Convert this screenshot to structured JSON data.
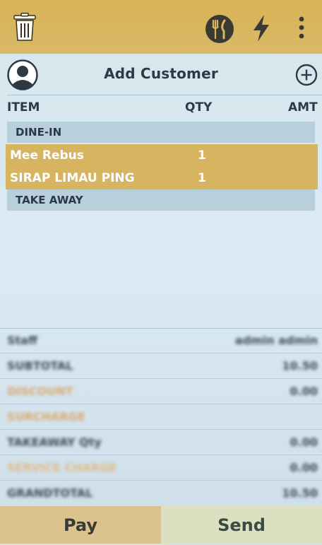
{
  "colors": {
    "accent": "#d8b256",
    "section_bg": "#b8cfdc",
    "selected_row": "#d7b460",
    "pay_button": "#dcc28c",
    "send_button": "#dce0c0",
    "summary_highlight": "#e6b88a"
  },
  "toolbar": {
    "icons": [
      "trash-icon",
      "restaurant-icon",
      "lightning-icon",
      "more-vertical-icon"
    ]
  },
  "customer": {
    "label": "Add Customer",
    "avatar_icon": "user-avatar-icon",
    "add_icon": "plus-circle-icon"
  },
  "order_table": {
    "headers": {
      "item": "ITEM",
      "qty": "QTY",
      "amt": "AMT"
    },
    "sections": [
      {
        "label": "DINE-IN",
        "items": [
          {
            "name": "Mee Rebus",
            "qty": "1",
            "amt": ""
          },
          {
            "name": "SIRAP LIMAU PING",
            "qty": "1",
            "amt": ""
          }
        ]
      },
      {
        "label": "TAKE AWAY",
        "items": []
      }
    ]
  },
  "summary": [
    {
      "label": "Staff",
      "value": "admin admin"
    },
    {
      "label": "SUBTOTAL",
      "value": "10.50"
    },
    {
      "label": "DISCOUNT",
      "value": "0.00"
    },
    {
      "label": "SURCHARGE",
      "value": ""
    },
    {
      "label": "TAKEAWAY Qty",
      "value": "0.00"
    },
    {
      "label": "SERVICE CHARGE",
      "value": "0.00"
    },
    {
      "label": "GRANDTOTAL",
      "value": "10.50"
    }
  ],
  "actions": {
    "pay": "Pay",
    "send": "Send"
  }
}
